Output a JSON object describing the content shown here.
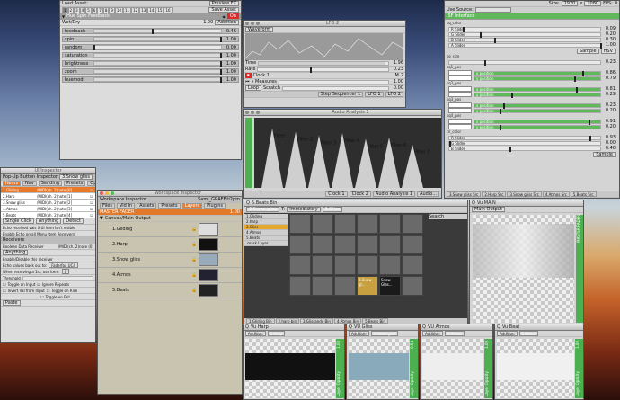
{
  "load_asset": {
    "label": "Load Asset:",
    "preview": "Preview FX",
    "save": "Save Asset"
  },
  "page_numbers": [
    "1",
    "2",
    "3",
    "4",
    "5",
    "6",
    "7",
    "8",
    "9",
    "10",
    "11",
    "12",
    "13",
    "14",
    "15",
    "16"
  ],
  "hue_spin": {
    "title": "Hue Spin Feedback",
    "on": "On",
    "wetdry_label": "Wet/Dry",
    "wetdry_value": "1.00",
    "mode": "Addition",
    "params": [
      {
        "name": "feedback",
        "value": "0.46",
        "frac": 0.46
      },
      {
        "name": "spin",
        "value": "1.00",
        "frac": 1
      },
      {
        "name": "random",
        "value": "0.00",
        "frac": 0
      },
      {
        "name": "saturation",
        "value": "1.00",
        "frac": 1
      },
      {
        "name": "brightness",
        "value": "1.00",
        "frac": 1
      },
      {
        "name": "zoom",
        "value": "1.00",
        "frac": 1
      },
      {
        "name": "huemod",
        "value": "1.00",
        "frac": 1
      }
    ]
  },
  "lfo": {
    "title": "LFO 2",
    "waveform": "Waveform",
    "time_label": "Time",
    "time_value": "1.96",
    "rate_label": "Rate",
    "rate_value": "0.23",
    "clock": "Clock 1",
    "m_label": "M",
    "m_value": "2",
    "measures_label": "Measures",
    "measures_value": "1.00",
    "loop": "Loop",
    "scratch_label": "Scratch",
    "scratch_value": "0.00",
    "seq_label": "Step Sequencer 1",
    "lfo1": "LFO 1",
    "lfo2": "LFO 2"
  },
  "audio": {
    "title": "Audio Analysis 1",
    "filters": [
      "Filter 1",
      "Filter 2",
      "Filter 3",
      "Filter 4",
      "Filter 5",
      "Filter 6",
      "Filter 7"
    ],
    "levels": [
      0.85,
      0.8,
      0.75,
      0.78,
      0.7,
      0.72,
      0.62
    ],
    "side": "10.00",
    "tabs": [
      "Clock 1",
      "Clock 2",
      "Audio Analysis 1",
      "Audio..."
    ]
  },
  "isf": {
    "size_label": "Size:",
    "width": "1920",
    "x": "x",
    "height": "1080",
    "fps_label": "FPS:",
    "fps": "0",
    "use_source": "Use Source:",
    "interface": "ISF Interface",
    "groups": [
      {
        "name": "sq_color",
        "rows": [
          {
            "l": "R Slider",
            "v": "0.09",
            "f": 0.09
          },
          {
            "l": "G Slider",
            "v": "0.20",
            "f": 0.2
          },
          {
            "l": "B Slider",
            "v": "0.30",
            "f": 0.3
          },
          {
            "l": "A Slider",
            "v": "1.00",
            "f": 1
          }
        ],
        "btn1": "Sample",
        "btn2": "HSV"
      },
      {
        "name": "sq_size",
        "rows": [
          {
            "l": "",
            "v": "0.23",
            "f": 0.23
          }
        ]
      },
      {
        "name": "sq1_pos",
        "rows": [
          {
            "l": "x position",
            "v": "0.86",
            "f": 0.86
          },
          {
            "l": "y position",
            "v": "0.79",
            "f": 0.79
          }
        ]
      },
      {
        "name": "sq2_pos",
        "rows": [
          {
            "l": "x position",
            "v": "0.81",
            "f": 0.81
          },
          {
            "l": "y position",
            "v": "0.29",
            "f": 0.29
          }
        ]
      },
      {
        "name": "sq3_pos",
        "rows": [
          {
            "l": "x position",
            "v": "0.23",
            "f": 0.23
          },
          {
            "l": "y position",
            "v": "0.20",
            "f": 0.2
          }
        ]
      },
      {
        "name": "sq4_pos",
        "rows": [
          {
            "l": "x position",
            "v": "0.91",
            "f": 0.91
          },
          {
            "l": "y position",
            "v": "0.20",
            "f": 0.2
          }
        ]
      },
      {
        "name": "tri_color",
        "rows": [
          {
            "l": "R Slider",
            "v": "0.93",
            "f": 0.93
          },
          {
            "l": "G Slider",
            "v": "0.00",
            "f": 0
          },
          {
            "l": "B Slider",
            "v": "0.40",
            "f": 0.4
          }
        ],
        "btn1": "Sample"
      }
    ],
    "tabs": [
      "3.Snow gliss Src",
      "2.Harp Src",
      "3.Snow gliss Src",
      "4.Atmos Src",
      "5.Beats Src"
    ]
  },
  "ui_inspector": {
    "title": "UI Inspector",
    "section": "Pop-Up Button Inspector",
    "name": "3.Snow gliss",
    "tabs": [
      "Items",
      "Nav",
      "Sending",
      "Presets",
      "Opts"
    ],
    "items": [
      {
        "n": "1.Gliding",
        "m": "/MIDI(ch. 2)note [0]"
      },
      {
        "n": "2.Harp",
        "m": "/MIDI(ch. 2)note [1]"
      },
      {
        "n": "3.Snow gliss",
        "m": "/MIDI(ch. 2)note [2]"
      },
      {
        "n": "4.Atmos",
        "m": "/MIDI(ch. 2)note [3]"
      },
      {
        "n": "5.Beats",
        "m": "/MIDI(ch. 2)note [4]"
      }
    ],
    "btn_single": "Single Click",
    "btn_anything": "Anything",
    "btn_detect": "Detect",
    "echo1": "Echo received vals if UI item isn't visible",
    "echo2": "Enable Echo on all Menu Item Receivers",
    "receivers": "Receivers",
    "boolean": "Boolean Data Receiver",
    "bool_midi": "/MIDI(ch. 2)note (0)",
    "anything": "Anything",
    "enable": "Enable/Disable this receiver",
    "send_back": "Echo values back out to:",
    "faderfox": "Faderfox UC4",
    "when": "When receiving a 1st, use item:",
    "when_val": "0",
    "threshold": "Threshold",
    "toggle_input": "Toggle on Input",
    "ignore": "Ignore Repeats",
    "invert": "Invert Val from Input",
    "toggle_rise": "Toggle on Rise",
    "toggle_fall": "Toggle on Fall",
    "paste": "Paste"
  },
  "workspace": {
    "title": "Workspace Inspector",
    "section": "Workspace Inspector",
    "user": "Sami_GRAFFiti2pm",
    "tabs": [
      "Files",
      "Vid In",
      "Assets",
      "Presets",
      "Layers",
      "Plugins"
    ],
    "master": "MASTER FADER",
    "master_val": "1.00",
    "group": "Canvas/Main Output",
    "layers": [
      "1.Gliding",
      "2.Harp",
      "3.Snow gliss",
      "4.Atmos",
      "5.Beats"
    ]
  },
  "beats_bin": {
    "title": "5.Beats Bin",
    "source": "3.Snow gliss",
    "mode": "Immediately",
    "items": [
      "1.Gliding",
      "2.harp",
      "3.Gliss",
      "4.Atmos",
      "5.Beats",
      ".mask Layer"
    ],
    "search": "Search",
    "target": "3.Gliss",
    "clip1": "3.Snow gl...",
    "clip2": "Snow Glas...",
    "tabs": [
      "1.Gliding Bin",
      "2.harp bin",
      "3.Glissando Bin",
      "4.Atmos Bin",
      "5.Beats Bin"
    ]
  },
  "vu_main": {
    "title": "Vu MAIN",
    "source": "Main Output",
    "fader": "MASTER FADER"
  },
  "vu": [
    {
      "title": "Vu Harp",
      "source": "2.Harp",
      "mode": "Addition",
      "val": "1.00",
      "side": "Layer Opacity"
    },
    {
      "title": "VU Gliss",
      "source": "3.Snow gliss",
      "mode": "Addition",
      "val": "0.54",
      "side": "Layer Opacity"
    },
    {
      "title": "VU Atmos",
      "source": "4.Atmos",
      "mode": "Addition",
      "val": "1.00",
      "side": "Layer Opacity"
    },
    {
      "title": "Vu Beat",
      "source": "5.Beats",
      "mode": "Addition",
      "val": "1.00",
      "side": "Layer Opacity"
    }
  ]
}
